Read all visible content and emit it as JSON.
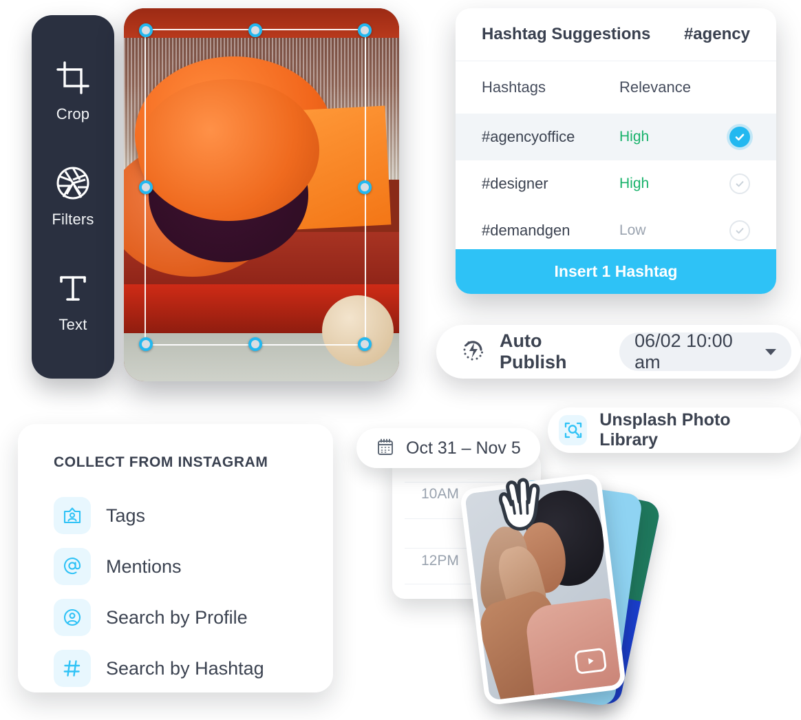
{
  "editor_toolbar": {
    "tools": [
      {
        "label": "Crop",
        "icon": "crop-icon"
      },
      {
        "label": "Filters",
        "icon": "aperture-icon"
      },
      {
        "label": "Text",
        "icon": "text-icon"
      }
    ]
  },
  "photo_editor": {
    "name": "photo-crop-canvas",
    "handles": 8
  },
  "hashtag_panel": {
    "title": "Hashtag Suggestions",
    "query": "#agency",
    "columns": {
      "hashtags": "Hashtags",
      "relevance": "Relevance"
    },
    "rows": [
      {
        "hashtag": "#agencyoffice",
        "relevance": "High",
        "relevance_level": "high",
        "selected": true
      },
      {
        "hashtag": "#designer",
        "relevance": "High",
        "relevance_level": "high",
        "selected": false
      },
      {
        "hashtag": "#demandgen",
        "relevance": "Low",
        "relevance_level": "low",
        "selected": false
      }
    ],
    "cta_label": "Insert 1 Hashtag"
  },
  "auto_publish": {
    "label": "Auto Publish",
    "icon": "auto-publish-bolt-icon",
    "datetime": "06/02  10:00 am"
  },
  "unsplash": {
    "label": "Unsplash Photo Library",
    "icon": "scan-search-icon"
  },
  "collect": {
    "title": "COLLECT FROM INSTAGRAM",
    "items": [
      {
        "label": "Tags",
        "icon": "tag-person-icon"
      },
      {
        "label": "Mentions",
        "icon": "at-icon"
      },
      {
        "label": "Search by Profile",
        "icon": "person-circle-icon"
      },
      {
        "label": "Search by Hashtag",
        "icon": "hash-icon"
      }
    ]
  },
  "calendar": {
    "range_label": "Oct 31 – Nov 5",
    "range_icon": "calendar-icon",
    "times": [
      "10AM",
      "12PM"
    ]
  },
  "media_stack": {
    "cursor_icon": "grab-hand-icon",
    "play_icon": "play-icon"
  },
  "colors": {
    "accent": "#2ec2f6",
    "accent_strong": "#22b8f0",
    "dark_panel": "#2a3040",
    "text_dark": "#3b4250",
    "relevance_high": "#17b26a",
    "relevance_low": "#9aa3af",
    "icon_tile": "#e8f7fe"
  }
}
